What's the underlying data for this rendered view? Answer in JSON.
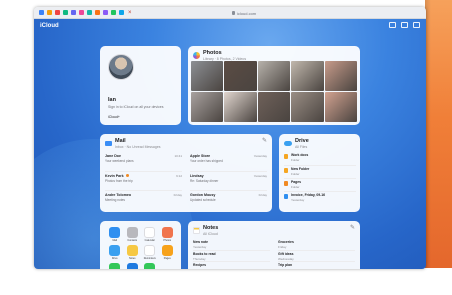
{
  "browser": {
    "url": "icloud.com",
    "tab_favicon_colors": [
      "#3b82f6",
      "#f59e0b",
      "#ef4444",
      "#10b981",
      "#6366f1",
      "#ec4899",
      "#14b8a6",
      "#f97316",
      "#8b5cf6",
      "#22c55e",
      "#0ea5e9"
    ],
    "close_glyph": "×"
  },
  "app": {
    "brand": "iCloud",
    "top_icons": [
      "grid-icon",
      "add-icon",
      "account-icon"
    ]
  },
  "profile": {
    "name": "Ian",
    "line1": "Sign in to iCloud on all your devices",
    "line2": "",
    "storage": "iCloud+"
  },
  "photos": {
    "title": "Photos",
    "subtitle": "Library · 8 Photos, 2 Videos",
    "thumb_colors": [
      "#8c8f94",
      "#5b4c44",
      "#b7b2ab",
      "#c1b8ad",
      "#c79b8a",
      "#a9a2a0",
      "#e1d6cf",
      "#6f615a",
      "#9a8e85",
      "#d2a290"
    ]
  },
  "mail": {
    "title": "Mail",
    "subtitle": "Inbox · No Unread Messages",
    "messages": [
      {
        "from": "Jane Doe",
        "subject": "Your weekend plans",
        "time": "10:41",
        "flag": false
      },
      {
        "from": "Apple Store",
        "subject": "Your order has shipped",
        "time": "Yesterday",
        "flag": false
      },
      {
        "from": "Kevin Park",
        "subject": "Photos from the trip",
        "time": "9:12",
        "flag": true
      },
      {
        "from": "Lindsay",
        "subject": "Re: Saturday dinner",
        "time": "Yesterday",
        "flag": false
      },
      {
        "from": "Andre Tolomeo",
        "subject": "Meeting notes",
        "time": "Friday",
        "flag": false
      },
      {
        "from": "Gordon Mousy",
        "subject": "Updated schedule",
        "time": "Friday",
        "flag": false
      }
    ]
  },
  "drive": {
    "title": "Drive",
    "subtitle": "All Files",
    "files": [
      {
        "name": "Work docs",
        "meta": "Folder",
        "color": "#f5a623"
      },
      {
        "name": "New Folder",
        "meta": "Folder",
        "color": "#f5a623"
      },
      {
        "name": "Pages",
        "meta": "Folder",
        "color": "#f08a24"
      },
      {
        "name": "Invoice, Friday, 09-16",
        "meta": "Yesterday",
        "color": "#2f8ff0"
      }
    ]
  },
  "apps": {
    "items": [
      {
        "label": "Mail",
        "color": "#2f8ff0"
      },
      {
        "label": "Contacts",
        "color": "#b8b8bd"
      },
      {
        "label": "Calendar",
        "color": "#ffffff"
      },
      {
        "label": "Photos",
        "color": "#f0744d"
      },
      {
        "label": "Drive",
        "color": "#3aa0f0"
      },
      {
        "label": "Notes",
        "color": "#f6c843"
      },
      {
        "label": "Reminders",
        "color": "#ffffff"
      },
      {
        "label": "Pages",
        "color": "#f7a21b"
      },
      {
        "label": "Numbers",
        "color": "#34c759"
      },
      {
        "label": "Keynote",
        "color": "#1f7ae0"
      },
      {
        "label": "Find",
        "color": "#34c759"
      },
      {
        "label": "",
        "color": ""
      }
    ]
  },
  "notes": {
    "title": "Notes",
    "subtitle": "All iCloud",
    "items": [
      {
        "title": "New note",
        "sub": "Yesterday"
      },
      {
        "title": "Groceries",
        "sub": "Friday"
      },
      {
        "title": "Books to read",
        "sub": "Thursday"
      },
      {
        "title": "Gift ideas",
        "sub": "Wednesday"
      },
      {
        "title": "Recipes",
        "sub": "Monday"
      },
      {
        "title": "Trip plan",
        "sub": "Monday"
      }
    ]
  }
}
